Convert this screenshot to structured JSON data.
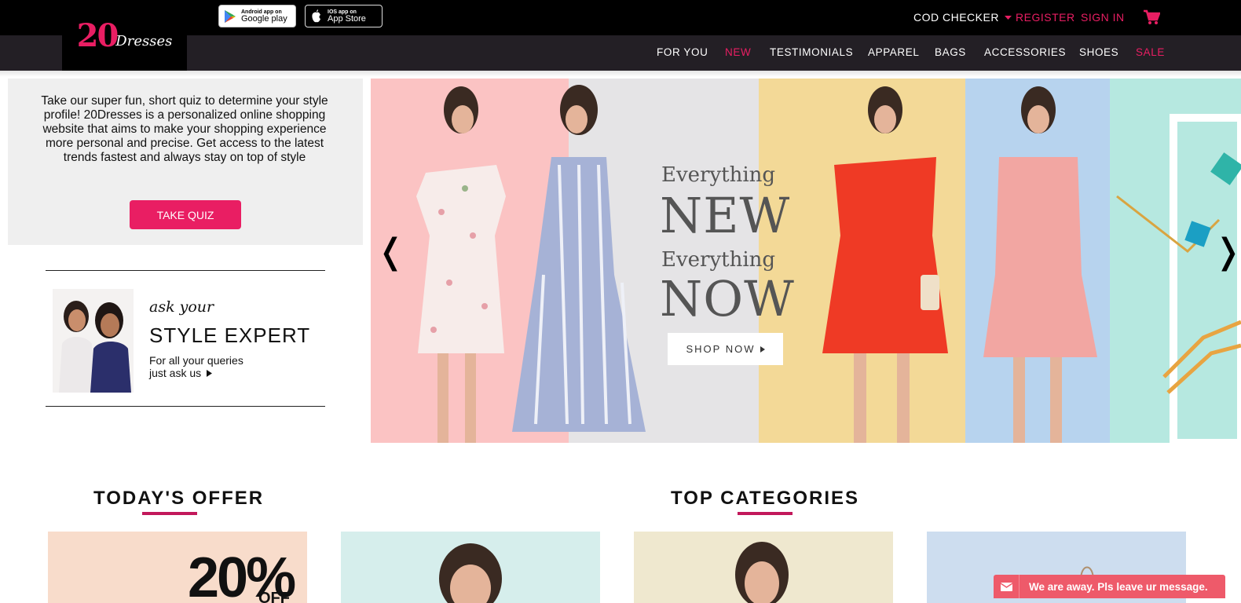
{
  "brand": {
    "number": "20",
    "word": "Dresses"
  },
  "stores": {
    "android": {
      "small": "Android app on",
      "big": "Google play"
    },
    "ios": {
      "small": "IOS app on",
      "big": "App Store"
    }
  },
  "top_links": {
    "cod": "COD CHECKER",
    "register": "REGISTER",
    "signin": "SIGN IN"
  },
  "nav": [
    "FOR YOU",
    "NEW",
    "TESTIMONIALS",
    "APPAREL",
    "BAGS",
    "ACCESSORIES",
    "SHOES",
    "SALE"
  ],
  "quiz": {
    "text": "Take our super fun, short quiz to determine your style profile! 20Dresses is a personalized online shopping website that aims to make your shopping experience more personal and precise. Get access to the latest trends fastest and always stay on top of style",
    "button": "TAKE QUIZ"
  },
  "expert": {
    "ask": "ask your",
    "title": "STYLE EXPERT",
    "line1": "For all your queries",
    "line2": "just ask us"
  },
  "hero": {
    "everything1": "Everything",
    "new": "NEW",
    "everything2": "Everything",
    "now": "NOW",
    "shop": "SHOP NOW"
  },
  "sections": {
    "offer": "TODAY'S OFFER",
    "categories": "TOP CATEGORIES"
  },
  "offer_card": {
    "percent": "20%",
    "off": "OFF"
  },
  "chat": {
    "message": "We are away. Pls leave ur message."
  },
  "colors": {
    "accent": "#e91e63",
    "topbar": "#000000",
    "navbar": "#231f25"
  }
}
